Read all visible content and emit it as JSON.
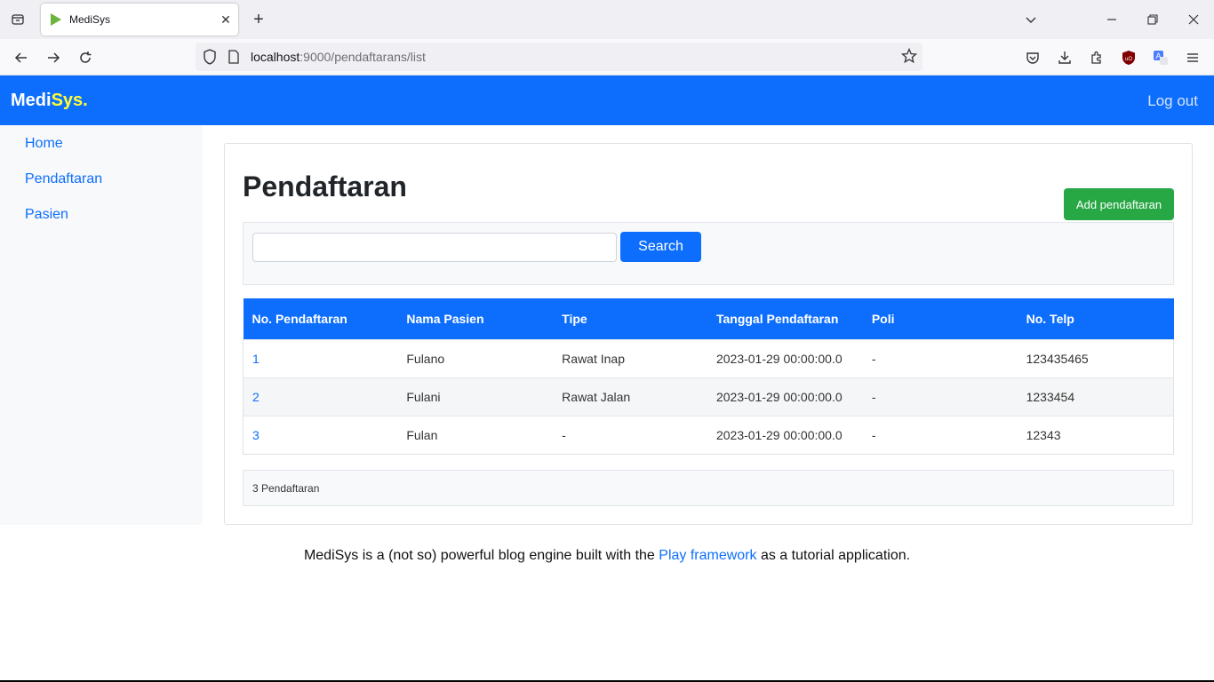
{
  "browser": {
    "tab_title": "MediSys",
    "url_host": "localhost",
    "url_path": ":9000/pendaftarans/list"
  },
  "header": {
    "brand_main": "Medi",
    "brand_accent": "Sys.",
    "logout": "Log out"
  },
  "sidebar": {
    "items": [
      {
        "label": "Home"
      },
      {
        "label": "Pendaftaran"
      },
      {
        "label": "Pasien"
      }
    ]
  },
  "main": {
    "title": "Pendaftaran",
    "add_button": "Add pendaftaran",
    "search": {
      "value": "",
      "button": "Search"
    },
    "columns": [
      "No. Pendaftaran",
      "Nama Pasien",
      "Tipe",
      "Tanggal Pendaftaran",
      "Poli",
      "No. Telp"
    ],
    "rows": [
      {
        "no": "1",
        "nama": "Fulano",
        "tipe": "Rawat Inap",
        "tanggal": "2023-01-29 00:00:00.0",
        "poli": "-",
        "telp": "123435465"
      },
      {
        "no": "2",
        "nama": "Fulani",
        "tipe": "Rawat Jalan",
        "tanggal": "2023-01-29 00:00:00.0",
        "poli": "-",
        "telp": "1233454"
      },
      {
        "no": "3",
        "nama": "Fulan",
        "tipe": "-",
        "tanggal": "2023-01-29 00:00:00.0",
        "poli": "-",
        "telp": "12343"
      }
    ],
    "summary": "3 Pendaftaran"
  },
  "footer": {
    "before": "MediSys is a (not so) powerful blog engine built with the ",
    "link": "Play framework",
    "after": " as a tutorial application."
  },
  "colors": {
    "primary": "#0d6efd",
    "success": "#28a745",
    "brand_accent": "#ffff33"
  }
}
